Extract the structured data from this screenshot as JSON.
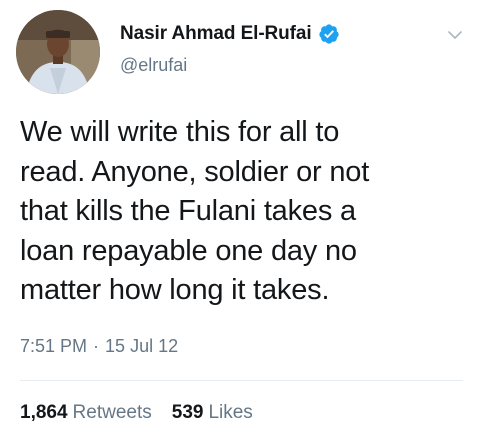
{
  "tweet": {
    "author": {
      "display_name": "Nasir Ahmad El-Rufai",
      "handle": "@elrufai",
      "verified": true,
      "avatar_icon": "profile-photo"
    },
    "menu_icon": "chevron-down-icon",
    "text": "We will write this for all to\nread. Anyone, soldier or not\nthat kills the Fulani takes a\nloan repayable one day no\nmatter how long it takes.",
    "time": "7:51 PM",
    "separator": "·",
    "date": "15 Jul 12",
    "stats": {
      "retweets_count": "1,864",
      "retweets_label": "Retweets",
      "likes_count": "539",
      "likes_label": "Likes"
    }
  },
  "colors": {
    "verified_blue": "#1da1f2",
    "text_primary": "#14171a",
    "text_secondary": "#657786",
    "divider": "#e6ecf0"
  }
}
